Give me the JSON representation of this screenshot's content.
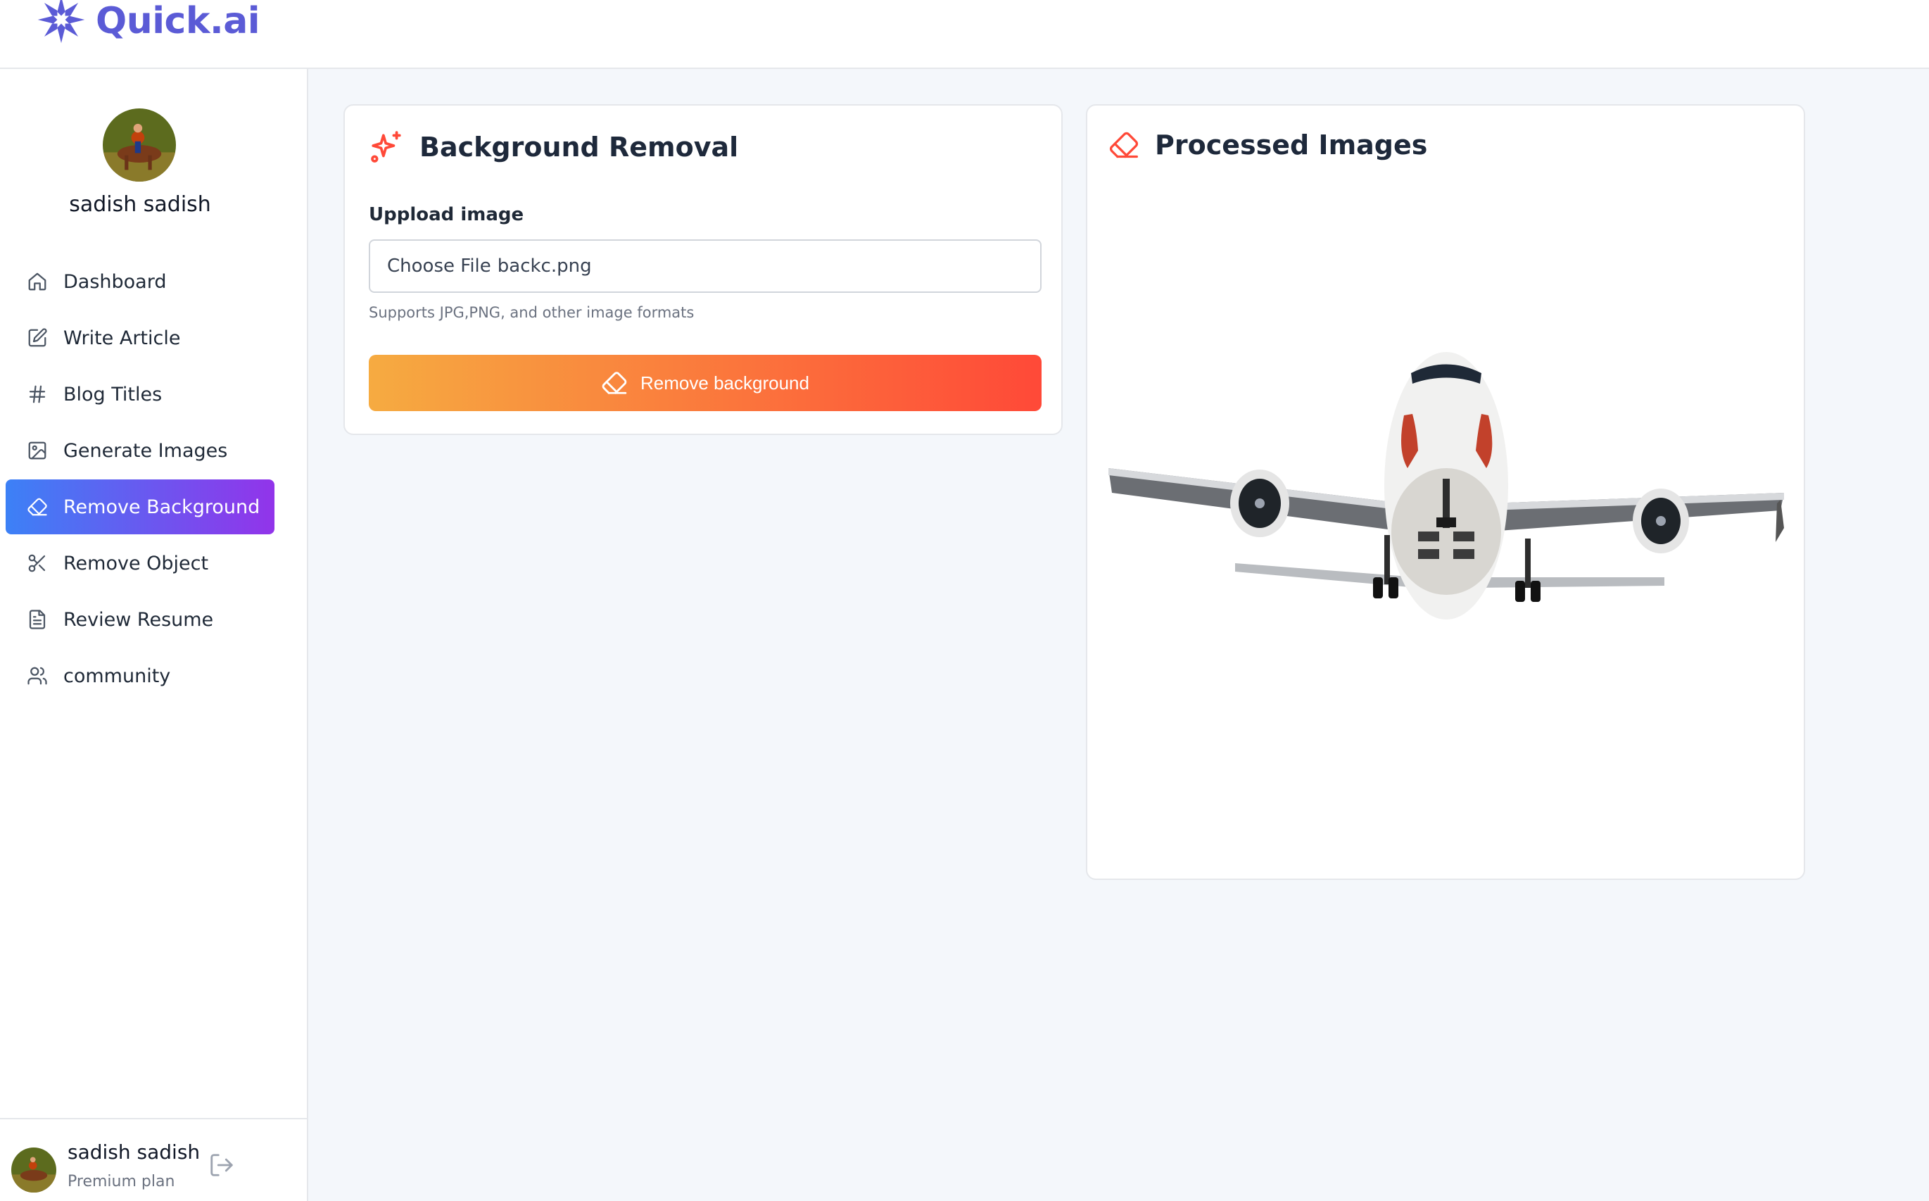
{
  "brand": {
    "name": "Quick.ai",
    "color": "#5b5bd6"
  },
  "user": {
    "name": "sadish sadish",
    "plan": "Premium plan"
  },
  "nav": {
    "items": [
      {
        "label": "Dashboard",
        "icon": "home-icon"
      },
      {
        "label": "Write Article",
        "icon": "pen-square-icon"
      },
      {
        "label": "Blog Titles",
        "icon": "hash-icon"
      },
      {
        "label": "Generate Images",
        "icon": "image-icon"
      },
      {
        "label": "Remove Background",
        "icon": "eraser-icon",
        "active": true
      },
      {
        "label": "Remove Object",
        "icon": "scissors-icon"
      },
      {
        "label": "Review Resume",
        "icon": "file-text-icon"
      },
      {
        "label": "community",
        "icon": "users-icon"
      }
    ],
    "active_gradient": [
      "#3c81f6",
      "#9234ea"
    ]
  },
  "left_card": {
    "title": "Background Removal",
    "upload_label": "Uppload image",
    "file_button": "Choose File",
    "file_name": "backc.png",
    "hint": "Supports JPG,PNG, and other image formats",
    "button_label": "Remove background",
    "button_gradient": [
      "#f6ab41",
      "#ff4938"
    ]
  },
  "right_card": {
    "title": "Processed Images",
    "image": "airplane-front-view-image"
  },
  "accent_icon_color": "#ff4938"
}
